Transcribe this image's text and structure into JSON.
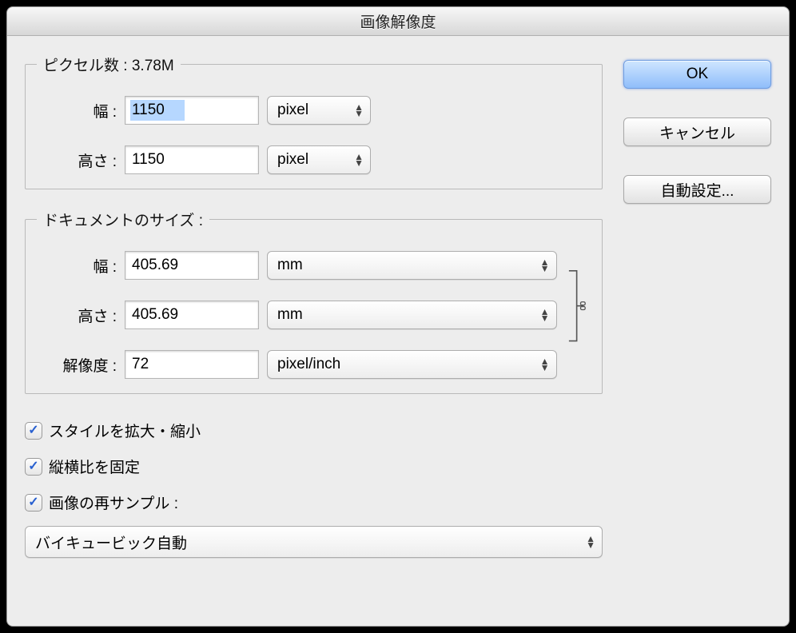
{
  "window": {
    "title": "画像解像度"
  },
  "pixel_section": {
    "legend_prefix": "ピクセル数 : ",
    "size_display": "3.78M",
    "width_label": "幅 :",
    "height_label": "高さ :",
    "width_value": "1150",
    "height_value": "1150",
    "width_unit": "pixel",
    "height_unit": "pixel"
  },
  "doc_section": {
    "legend": "ドキュメントのサイズ :",
    "width_label": "幅 :",
    "height_label": "高さ :",
    "res_label": "解像度 :",
    "width_value": "405.69",
    "height_value": "405.69",
    "res_value": "72",
    "width_unit": "mm",
    "height_unit": "mm",
    "res_unit": "pixel/inch"
  },
  "checks": {
    "scale_styles": "スタイルを拡大・縮小",
    "constrain": "縦横比を固定",
    "resample_label": "画像の再サンプル :"
  },
  "resample_method": "バイキュービック自動",
  "buttons": {
    "ok": "OK",
    "cancel": "キャンセル",
    "auto": "自動設定..."
  }
}
